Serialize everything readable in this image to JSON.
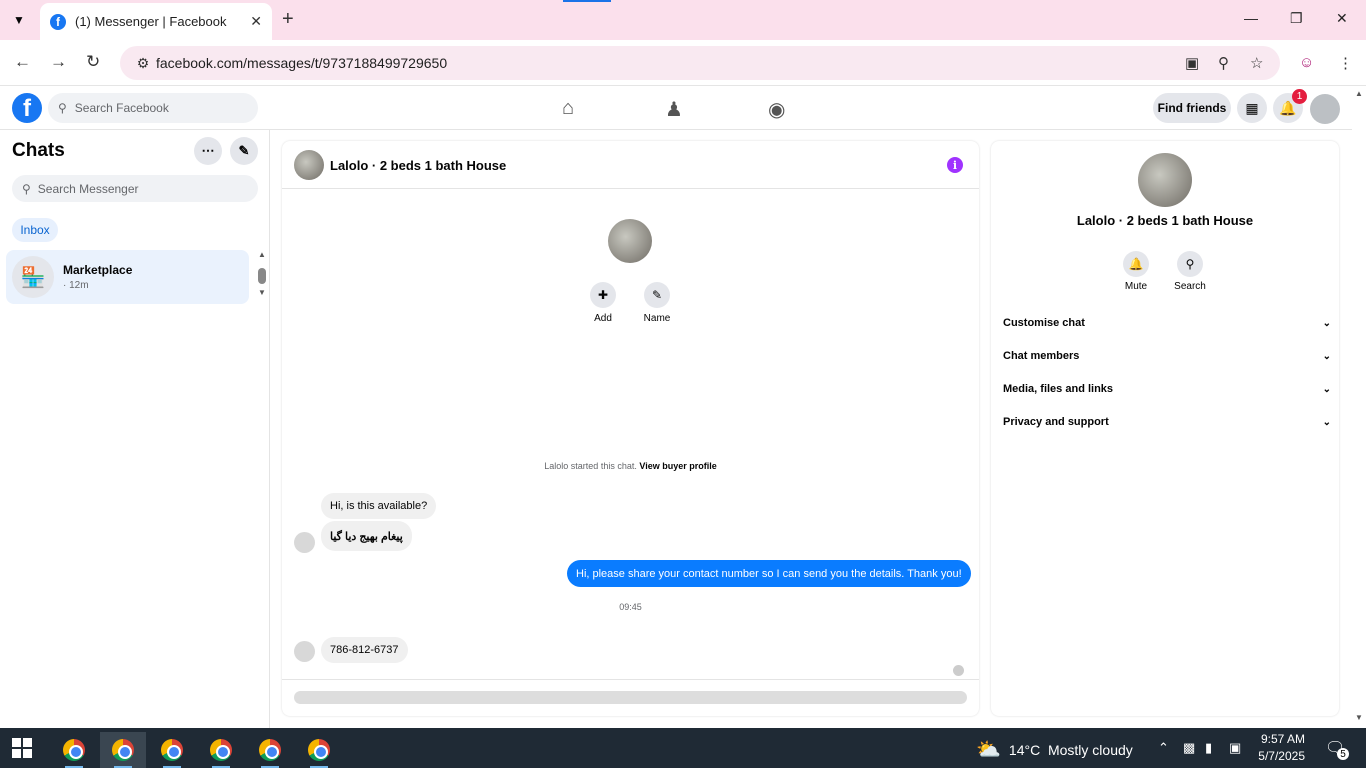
{
  "browser": {
    "tab_title": "(1) Messenger | Facebook",
    "favicon": "f",
    "url": "facebook.com/messages/t/9737188499729650"
  },
  "fb_header": {
    "logo": "f",
    "search_placeholder": "Search Facebook",
    "find_friends": "Find friends",
    "notification_count": "1"
  },
  "sidebar": {
    "title": "Chats",
    "search_placeholder": "Search Messenger",
    "filter": "Inbox",
    "conversations": [
      {
        "name": "Marketplace",
        "time": "· 12m"
      }
    ]
  },
  "chat": {
    "title": "Lalolo · 2 beds 1 bath House",
    "actions": [
      {
        "label": "Add",
        "icon": "add-person-icon"
      },
      {
        "label": "Name",
        "icon": "pencil-icon"
      }
    ],
    "started_text": "Lalolo started this chat.",
    "view_profile": "View buyer profile",
    "messages": [
      {
        "from": "other",
        "text": "Hi, is this available?"
      },
      {
        "from": "other",
        "text": "پیغام بھیج دیا گیا"
      },
      {
        "from": "me",
        "text": "Hi, please share your contact number so I can send you the details. Thank you!"
      },
      {
        "from": "other",
        "text": "786-812-6737"
      }
    ],
    "timestamp": "09:45"
  },
  "info_panel": {
    "title": "Lalolo · 2 beds 1 bath House",
    "mute": "Mute",
    "search": "Search",
    "sections": [
      "Customise chat",
      "Chat members",
      "Media, files and links",
      "Privacy and support"
    ]
  },
  "taskbar": {
    "temperature": "14°C",
    "weather": "Mostly cloudy",
    "time": "9:57 AM",
    "date": "5/7/2025",
    "notification_count": "5"
  },
  "colors": {
    "facebook_blue": "#1877f2",
    "message_blue": "#0a7cff",
    "info_purple": "#a033ff",
    "tab_strip": "#fbe0ec"
  }
}
